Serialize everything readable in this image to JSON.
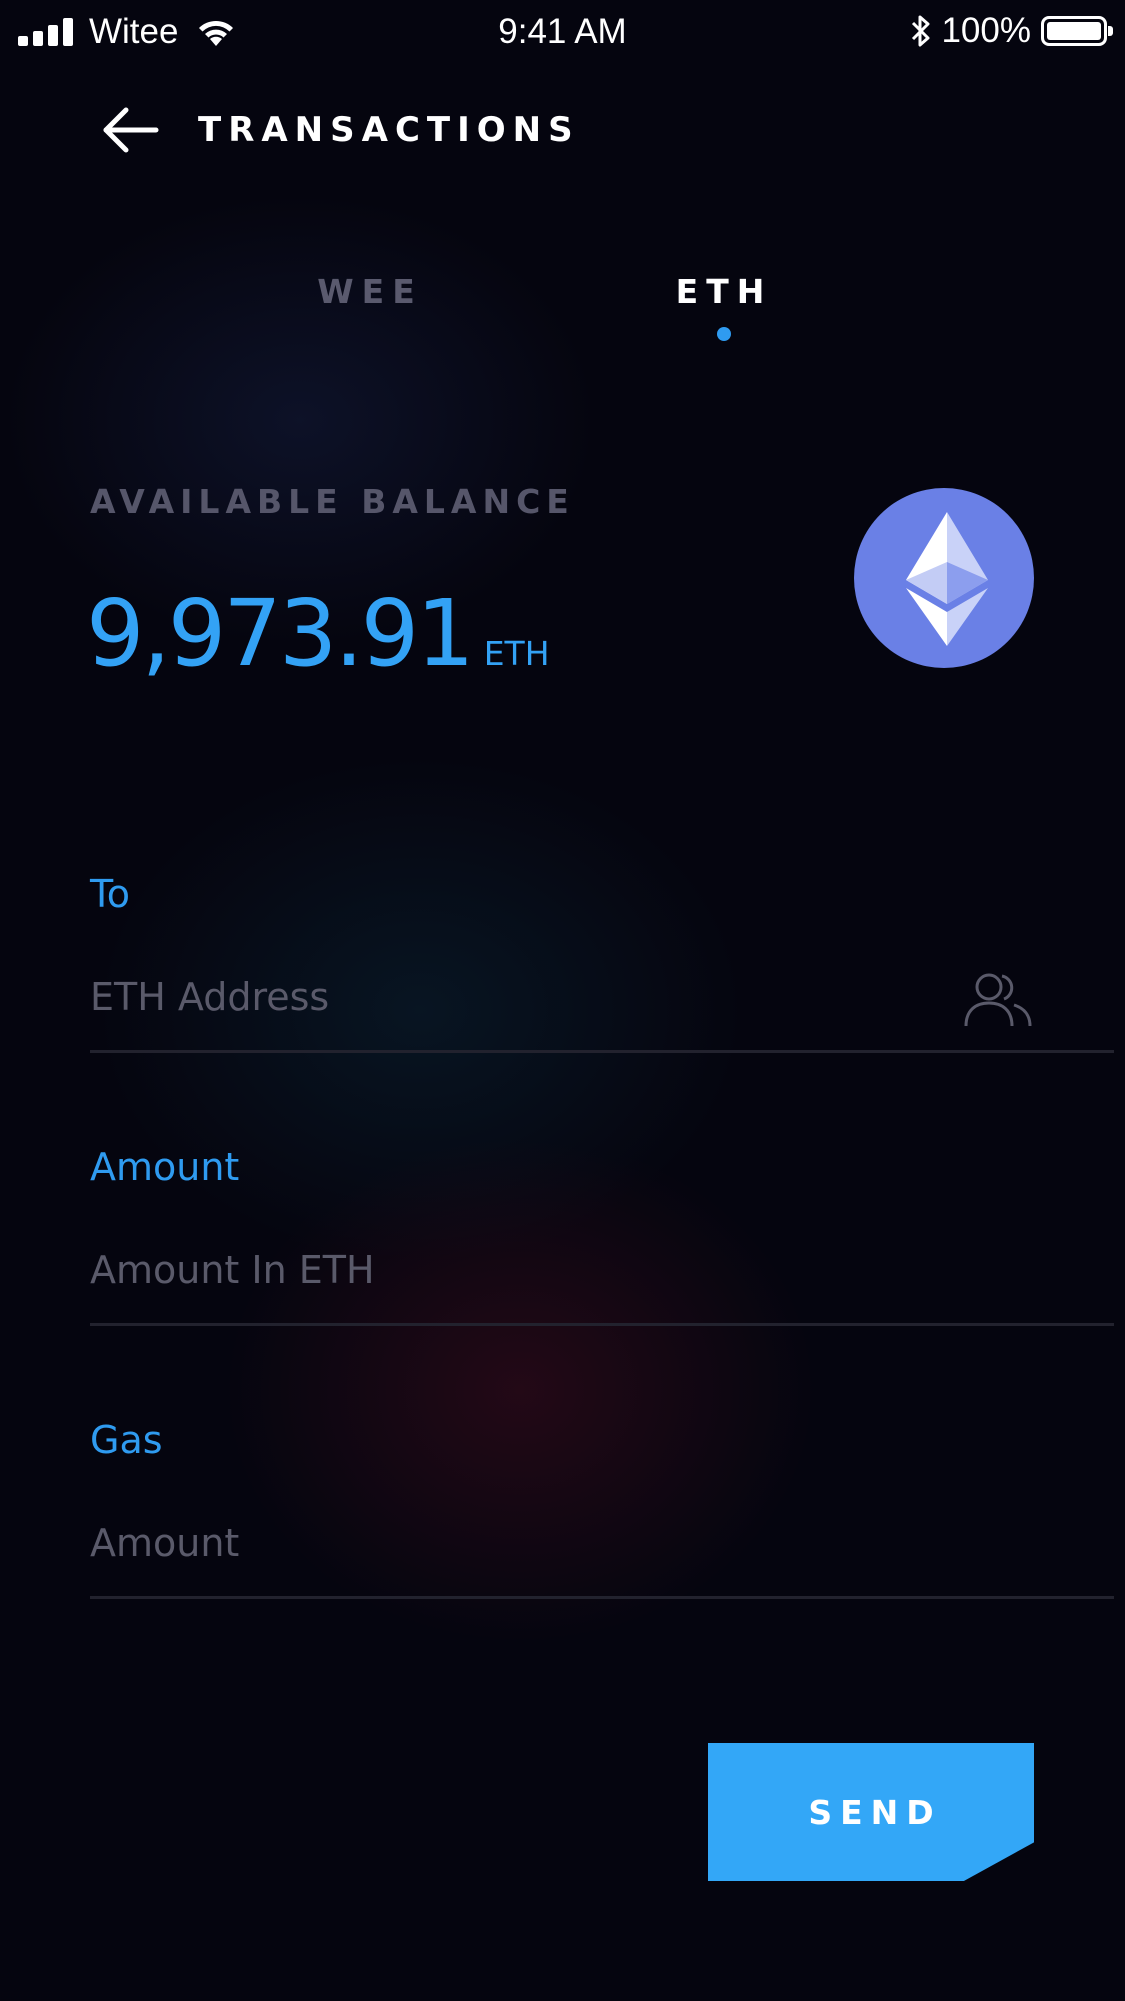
{
  "status_bar": {
    "carrier": "Witee",
    "time": "9:41 AM",
    "battery": "100%"
  },
  "header": {
    "title": "TRANSACTIONS"
  },
  "tabs": [
    {
      "label": "WEE",
      "active": false
    },
    {
      "label": "ETH",
      "active": true
    }
  ],
  "balance": {
    "label": "AVAILABLE BALANCE",
    "value": "9,973.91",
    "unit": "ETH"
  },
  "form": {
    "to": {
      "label": "To",
      "placeholder": "ETH Address"
    },
    "amount": {
      "label": "Amount",
      "placeholder": "Amount In ETH"
    },
    "gas": {
      "label": "Gas",
      "placeholder": "Amount"
    }
  },
  "actions": {
    "send_label": "SEND"
  },
  "colors": {
    "accent": "#33a7f7",
    "background": "#05050f",
    "muted_text": "#5a5a6e",
    "eth_logo": "#6a80e6"
  },
  "icons": {
    "back": "arrow-left-icon",
    "contacts": "contacts-icon",
    "eth": "ethereum-logo-icon"
  }
}
